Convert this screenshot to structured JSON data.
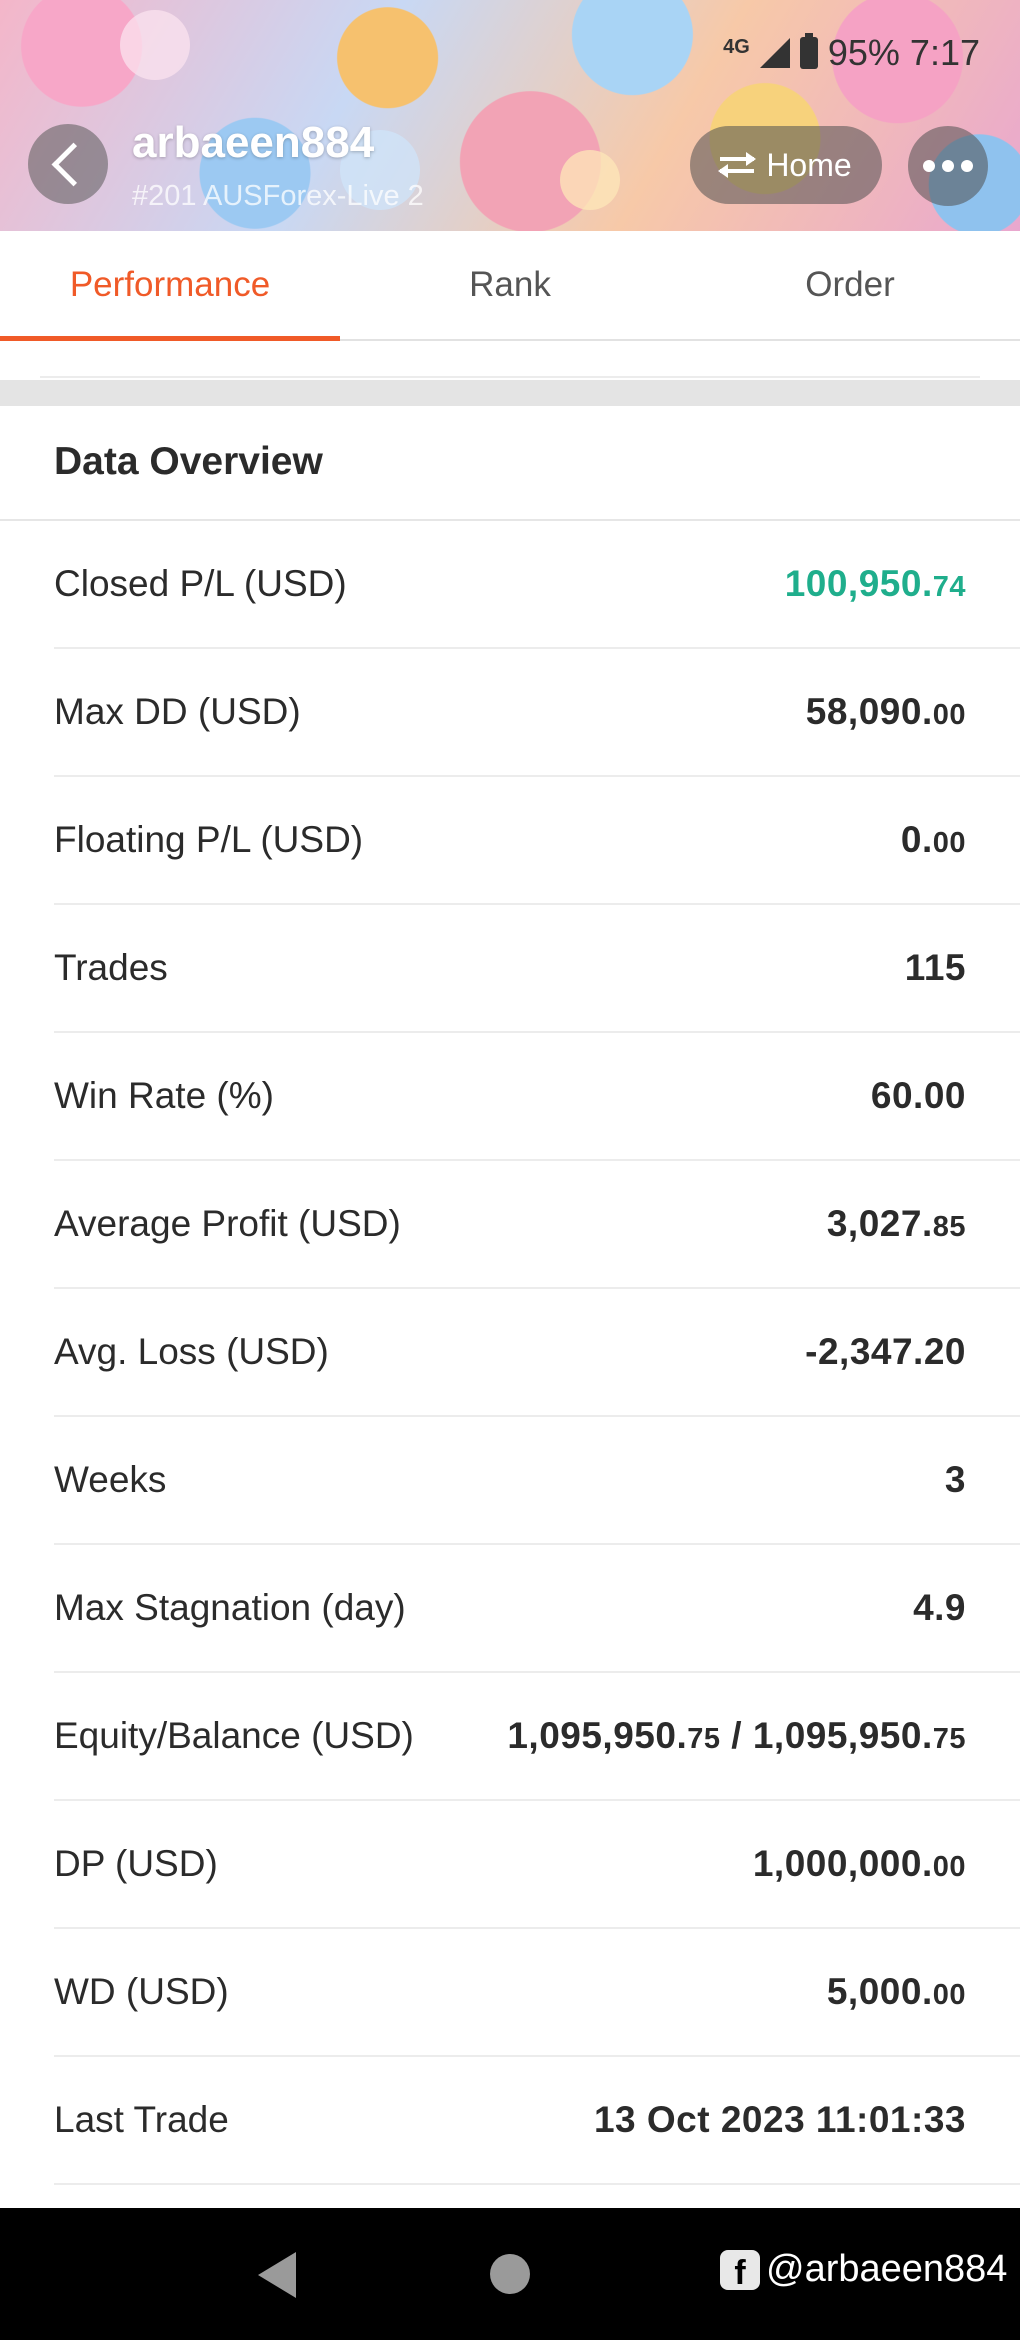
{
  "status_bar": {
    "network": "4G",
    "battery": "95%",
    "time": "7:17"
  },
  "header": {
    "user_name": "arbaeen884",
    "server": "#201 AUSForex-Live 2",
    "home_label": "Home"
  },
  "tabs": [
    {
      "label": "Performance",
      "active": true
    },
    {
      "label": "Rank",
      "active": false
    },
    {
      "label": "Order",
      "active": false
    }
  ],
  "overview": {
    "title": "Data Overview",
    "rows": [
      {
        "label": "Closed P/L (USD)",
        "value_main": "100,950.",
        "value_dec": "74",
        "color": "#1fae8c"
      },
      {
        "label": "Max DD (USD)",
        "value_main": "58,090.",
        "value_dec": "00"
      },
      {
        "label": "Floating P/L (USD)",
        "value_main": "0.",
        "value_dec": "00"
      },
      {
        "label": "Trades",
        "value_main": "115",
        "value_dec": ""
      },
      {
        "label": "Win Rate (%)",
        "value_main": "60.00",
        "value_dec": ""
      },
      {
        "label": "Average Profit (USD)",
        "value_main": "3,027.",
        "value_dec": "85"
      },
      {
        "label": "Avg. Loss (USD)",
        "value_main": "-2,347.20",
        "value_dec": ""
      },
      {
        "label": "Weeks",
        "value_main": "3",
        "value_dec": ""
      },
      {
        "label": "Max Stagnation (day)",
        "value_main": "4.9",
        "value_dec": ""
      },
      {
        "label": "Equity/Balance (USD)",
        "value_main": "1,095,950.",
        "value_dec": "75",
        "value_main2": " / 1,095,950.",
        "value_dec2": "75"
      },
      {
        "label": "DP (USD)",
        "value_main": "1,000,000.",
        "value_dec": "00"
      },
      {
        "label": "WD (USD)",
        "value_main": "5,000.",
        "value_dec": "00"
      },
      {
        "label": "Last Trade",
        "value_main": "13 Oct 2023 11:01:33",
        "value_dec": ""
      }
    ]
  },
  "watermark": {
    "fb_letter": "f",
    "text": "@arbaeen884"
  }
}
